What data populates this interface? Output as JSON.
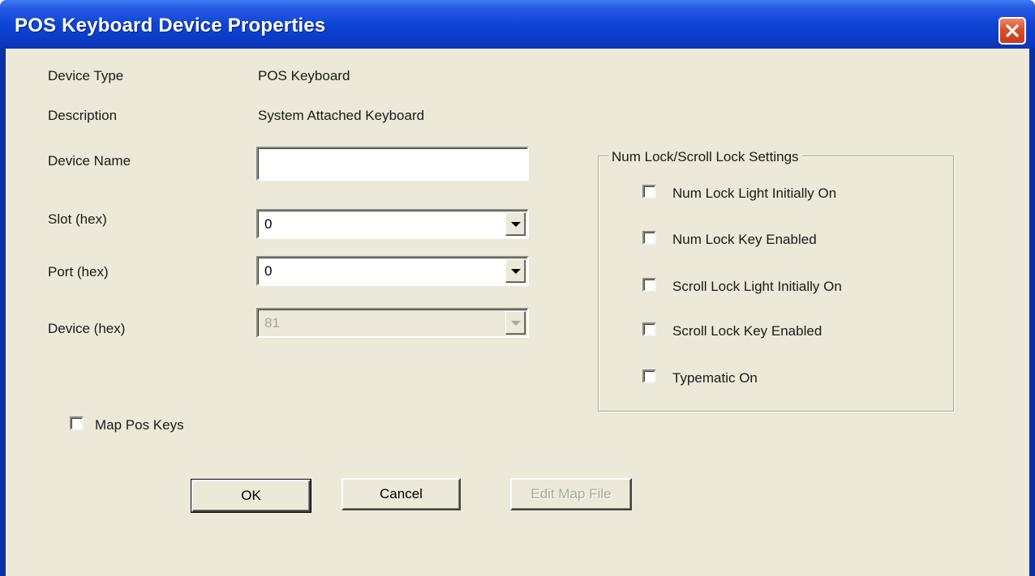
{
  "window": {
    "title": "POS Keyboard Device Properties",
    "close_icon": "close-icon"
  },
  "fields": {
    "device_type_label": "Device Type",
    "device_type_value": "POS Keyboard",
    "description_label": "Description",
    "description_value": "System Attached Keyboard",
    "device_name_label": "Device Name",
    "device_name_value": "",
    "slot_label": "Slot (hex)",
    "slot_value": "0",
    "port_label": "Port (hex)",
    "port_value": "0",
    "device_label": "Device (hex)",
    "device_value": "81"
  },
  "map_pos_keys": {
    "label": "Map Pos Keys",
    "checked": false
  },
  "lock_settings": {
    "title": "Num Lock/Scroll Lock Settings",
    "options": [
      {
        "label": "Num Lock Light Initially On",
        "checked": false
      },
      {
        "label": "Num Lock Key Enabled",
        "checked": false
      },
      {
        "label": "Scroll Lock Light Initially On",
        "checked": false
      },
      {
        "label": "Scroll Lock Key Enabled",
        "checked": false
      },
      {
        "label": "Typematic On",
        "checked": false
      }
    ]
  },
  "buttons": {
    "ok": "OK",
    "cancel": "Cancel",
    "edit_map_file": "Edit Map File"
  },
  "colors": {
    "titlebar": "#0b3bc8",
    "dialog_face": "#ece9d8",
    "close_button": "#d8502c",
    "disabled_text": "#a9a79b"
  }
}
